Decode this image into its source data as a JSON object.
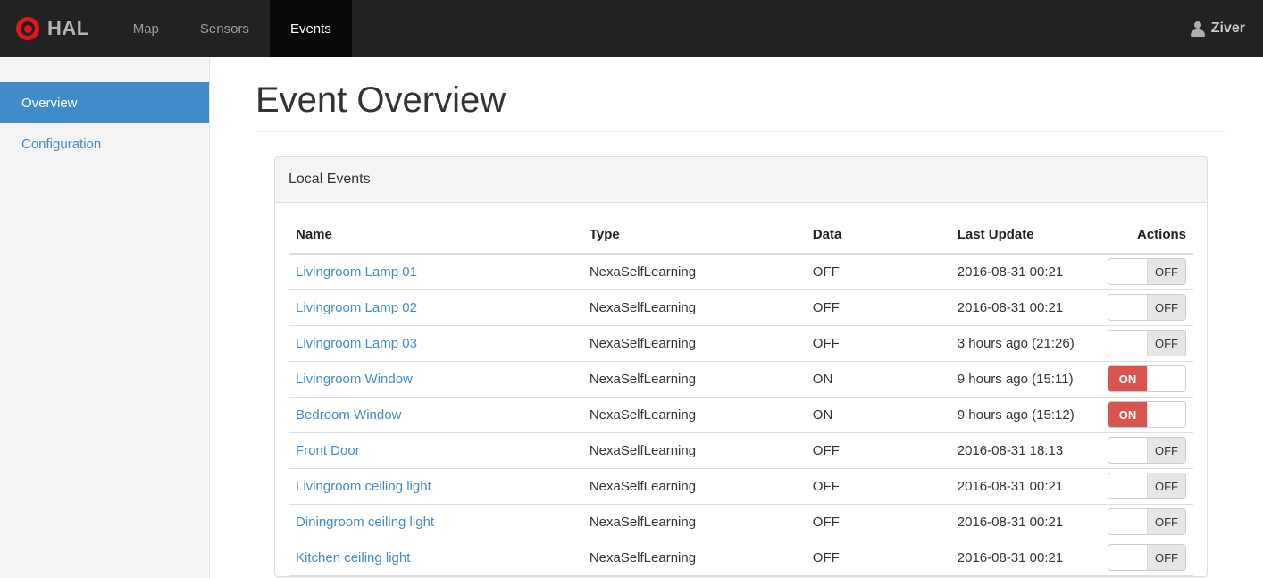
{
  "navbar": {
    "brand": "HAL",
    "items": [
      {
        "label": "Map",
        "active": false
      },
      {
        "label": "Sensors",
        "active": false
      },
      {
        "label": "Events",
        "active": true
      }
    ],
    "user": "Ziver"
  },
  "sidebar": {
    "items": [
      {
        "label": "Overview",
        "active": true
      },
      {
        "label": "Configuration",
        "active": false
      }
    ]
  },
  "main": {
    "title": "Event Overview",
    "panel": {
      "title": "Local Events",
      "table": {
        "columns": [
          "Name",
          "Type",
          "Data",
          "Last Update",
          "Actions"
        ],
        "rows": [
          {
            "name": "Livingroom Lamp 01",
            "type": "NexaSelfLearning",
            "data": "OFF",
            "last_update": "2016-08-31 00:21",
            "switch": "OFF"
          },
          {
            "name": "Livingroom Lamp 02",
            "type": "NexaSelfLearning",
            "data": "OFF",
            "last_update": "2016-08-31 00:21",
            "switch": "OFF"
          },
          {
            "name": "Livingroom Lamp 03",
            "type": "NexaSelfLearning",
            "data": "OFF",
            "last_update": "3 hours ago (21:26)",
            "switch": "OFF"
          },
          {
            "name": "Livingroom Window",
            "type": "NexaSelfLearning",
            "data": "ON",
            "last_update": "9 hours ago (15:11)",
            "switch": "ON"
          },
          {
            "name": "Bedroom Window",
            "type": "NexaSelfLearning",
            "data": "ON",
            "last_update": "9 hours ago (15:12)",
            "switch": "ON"
          },
          {
            "name": "Front Door",
            "type": "NexaSelfLearning",
            "data": "OFF",
            "last_update": "2016-08-31 18:13",
            "switch": "OFF"
          },
          {
            "name": "Livingroom ceiling light",
            "type": "NexaSelfLearning",
            "data": "OFF",
            "last_update": "2016-08-31 00:21",
            "switch": "OFF"
          },
          {
            "name": "Diningroom ceiling light",
            "type": "NexaSelfLearning",
            "data": "OFF",
            "last_update": "2016-08-31 00:21",
            "switch": "OFF"
          },
          {
            "name": "Kitchen ceiling light",
            "type": "NexaSelfLearning",
            "data": "OFF",
            "last_update": "2016-08-31 00:21",
            "switch": "OFF"
          }
        ]
      }
    }
  },
  "colors": {
    "navbar_bg": "#222222",
    "navbar_active_bg": "#080808",
    "accent_blue": "#428bca",
    "switch_on_red": "#d9534f",
    "sidebar_bg": "#f4f4f4",
    "panel_heading_bg": "#f5f5f5",
    "logo_red": "#e8141b"
  }
}
